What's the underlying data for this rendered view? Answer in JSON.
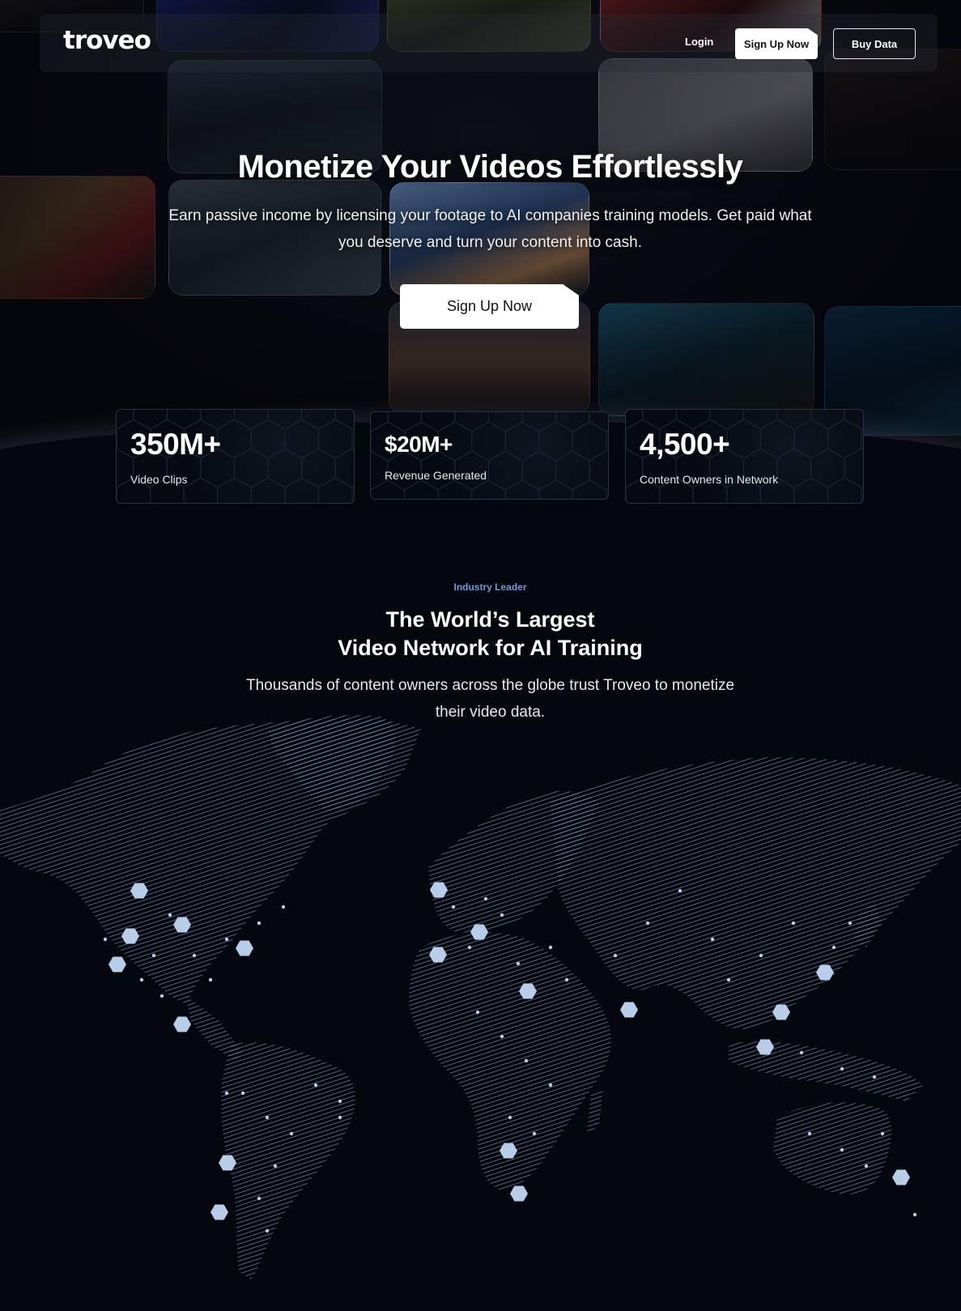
{
  "nav": {
    "logo": "troveo",
    "login": "Login",
    "signup": "Sign Up Now",
    "buy": "Buy Data"
  },
  "hero": {
    "title": "Monetize Your Videos Effortlessly",
    "subtitle": "Earn passive income by licensing your footage to AI companies training models. Get paid what you deserve and turn your content into cash.",
    "cta": "Sign Up Now"
  },
  "stats": [
    {
      "value": "350M+",
      "label": "Video Clips"
    },
    {
      "value": "$20M+",
      "label": "Revenue Generated"
    },
    {
      "value": "4,500+",
      "label": "Content Owners in Network"
    }
  ],
  "network": {
    "eyebrow": "Industry Leader",
    "title_line1": "The World’s Largest",
    "title_line2": "Video Network for AI Training",
    "subtitle": "Thousands of content owners across the globe trust Troveo to monetize their video data."
  },
  "colors": {
    "background": "#05070f",
    "accent": "#6f9ad8",
    "map_lines": "#8fa6c8",
    "hex_marker": "#b8cde8"
  }
}
